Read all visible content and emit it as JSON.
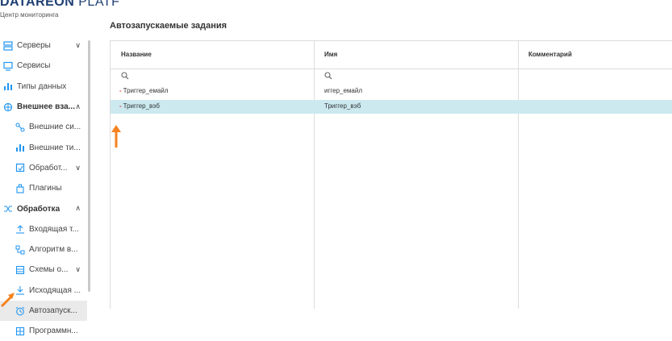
{
  "brand": {
    "name_bold": "DATAREON",
    "name_thin": "PLATF",
    "subtitle": "Центр мониторинга"
  },
  "sidebar": {
    "items": [
      {
        "label": "Серверы",
        "icon": "server-icon"
      },
      {
        "label": "Сервисы",
        "icon": "monitor-icon"
      },
      {
        "label": "Типы данных",
        "icon": "chart-icon"
      },
      {
        "label": "Внешнее вза...",
        "icon": "network-icon"
      },
      {
        "label": "Внешние си...",
        "icon": "link-icon"
      },
      {
        "label": "Внешние ти...",
        "icon": "chart-icon"
      },
      {
        "label": "Обработ...",
        "icon": "handler-icon"
      },
      {
        "label": "Плагины",
        "icon": "plugin-icon"
      },
      {
        "label": "Обработка",
        "icon": "shuffle-icon"
      },
      {
        "label": "Входящая т...",
        "icon": "upload-icon"
      },
      {
        "label": "Алгоритм в...",
        "icon": "algorithm-icon"
      },
      {
        "label": "Схемы о...",
        "icon": "schema-icon"
      },
      {
        "label": "Исходящая ...",
        "icon": "download-icon"
      },
      {
        "label": "Автозапуск...",
        "icon": "alarm-clock-icon"
      },
      {
        "label": "Программн...",
        "icon": "grid-icon"
      }
    ]
  },
  "main": {
    "title": "Автозапускаемые задания",
    "columns": [
      "Название",
      "Имя",
      "Комментарий"
    ],
    "rows": [
      {
        "name": "Триггер_емайл",
        "id": "иггер_емайл",
        "comment": ""
      },
      {
        "name": "Триггер_вэб",
        "id": "Триггер_вэб",
        "comment": ""
      }
    ]
  },
  "colors": {
    "accent": "#1d3f72",
    "selected_row": "#cbe9ef",
    "arrow": "#f5821f",
    "icon_blue": "#2196f3"
  }
}
